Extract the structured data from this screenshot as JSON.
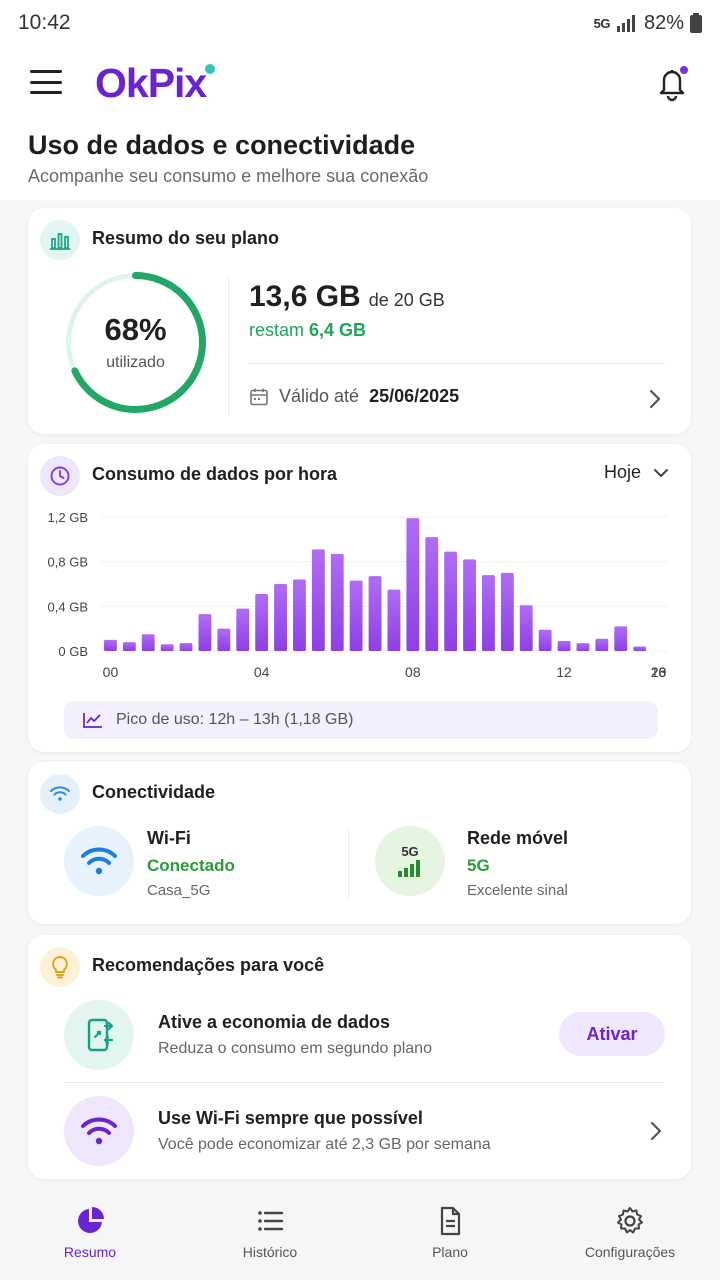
{
  "status_bar": {
    "time": "10:42",
    "network": "5G",
    "battery": "82%"
  },
  "header": {
    "logo": "OkPix",
    "title": "Uso de dados e conectividade",
    "subtitle": "Acompanhe seu consumo e melhore sua conexão"
  },
  "plan": {
    "title": "Resumo do seu plano",
    "percent_label": "68%",
    "percent_value": 68,
    "used_label": "utilizado",
    "used": "13,6 GB",
    "total": "de 20 GB",
    "remaining_prefix": "restam",
    "remaining": "6,4 GB",
    "valid_prefix": "Válido até",
    "valid_date": "25/06/2025"
  },
  "usage": {
    "title": "Consumo de dados por hora",
    "period": "Hoje",
    "peak": "Pico de uso: 12h – 13h (1,18 GB)"
  },
  "chart_data": {
    "type": "bar",
    "y_tick_labels": [
      "0 GB",
      "0,4 GB",
      "0,8 GB",
      "1,2 GB"
    ],
    "y_ticks": [
      0,
      0.4,
      0.8,
      1.2
    ],
    "ylim": [
      0,
      1.2
    ],
    "x_tick_labels": [
      "00",
      "04",
      "08",
      "12",
      "16",
      "20",
      "23"
    ],
    "x_tick_hours": [
      0,
      4,
      8,
      12,
      16,
      20,
      23
    ],
    "categories": [
      "00",
      "00:30",
      "01",
      "01:30",
      "02",
      "02:30",
      "03",
      "03:30",
      "04",
      "04:30",
      "05",
      "05:30",
      "06",
      "06:30",
      "07",
      "07:30",
      "08",
      "08:30",
      "09",
      "09:30",
      "10",
      "10:30",
      "11",
      "11:30",
      "12",
      "12:30",
      "13",
      "13:30",
      "14",
      "14:30"
    ],
    "hours": [
      0,
      1,
      2,
      3,
      4,
      5,
      6,
      7,
      8,
      9,
      10,
      11,
      12,
      13,
      14,
      15,
      16,
      17,
      18,
      19,
      20,
      21,
      22,
      23,
      24,
      25,
      26,
      27,
      28,
      29
    ],
    "values": [
      0.1,
      0.08,
      0.15,
      0.06,
      0.07,
      0.33,
      0.2,
      0.38,
      0.51,
      0.6,
      0.64,
      0.91,
      0.87,
      0.63,
      0.67,
      0.55,
      1.19,
      1.02,
      0.89,
      0.82,
      0.68,
      0.7,
      0.41,
      0.19,
      0.09,
      0.07,
      0.11,
      0.22,
      0.04,
      0.0
    ],
    "color": "#a259ee"
  },
  "connectivity": {
    "title": "Conectividade",
    "wifi": {
      "name": "Wi-Fi",
      "status": "Conectado",
      "detail": "Casa_5G"
    },
    "mobile": {
      "name": "Rede móvel",
      "badge": "5G",
      "status": "5G",
      "detail": "Excelente sinal"
    }
  },
  "recommendations": {
    "title": "Recomendações para você",
    "items": [
      {
        "title": "Ative a economia de dados",
        "desc": "Reduza o consumo em segundo plano",
        "action": "Ativar"
      },
      {
        "title": "Use Wi-Fi sempre que possível",
        "desc": "Você pode economizar até 2,3 GB por semana"
      }
    ]
  },
  "nav": [
    {
      "label": "Resumo"
    },
    {
      "label": "Histórico"
    },
    {
      "label": "Plano"
    },
    {
      "label": "Configurações"
    }
  ],
  "colors": {
    "brand": "#6a23d1",
    "accent_green": "#20a45a",
    "bar": "#a259ee",
    "teal": "#2fc7b3"
  }
}
